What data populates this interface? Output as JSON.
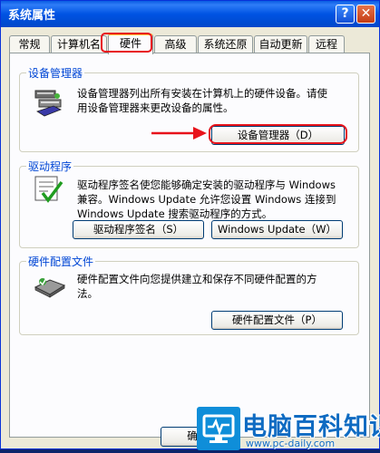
{
  "window": {
    "title": "系统属性",
    "help_label": "?",
    "close_label": "✕"
  },
  "tabs": [
    {
      "label": "常规"
    },
    {
      "label": "计算机名"
    },
    {
      "label": "硬件",
      "active": true
    },
    {
      "label": "高级"
    },
    {
      "label": "系统还原"
    },
    {
      "label": "自动更新"
    },
    {
      "label": "远程"
    }
  ],
  "device_manager": {
    "title": "设备管理器",
    "description_lines": [
      "设备管理器列出所有安装在计算机上的硬件设备。请使",
      "用设备管理器来更改设备的属性。"
    ],
    "button_label": "设备管理器（D）"
  },
  "drivers": {
    "title": "驱动程序",
    "description_lines": [
      "驱动程序签名使您能够确定安装的驱动程序与 Windows",
      "兼容。Windows Update 允许您设置 Windows 连接到",
      "Windows Update 搜索驱动程序的方式。"
    ],
    "signing_button_label": "驱动程序签名（S）",
    "update_button_label": "Windows Update（W）"
  },
  "hardware_profiles": {
    "title": "硬件配置文件",
    "description_lines": [
      "硬件配置文件向您提供建立和保存不同硬件配置的方",
      "法。"
    ],
    "button_label": "硬件配置文件（P）"
  },
  "bottom": {
    "ok_label": "确"
  },
  "watermark": {
    "brand": "电脑百科知识",
    "url": "www.pc-daily.com"
  },
  "annotation_color": "#e8131b"
}
